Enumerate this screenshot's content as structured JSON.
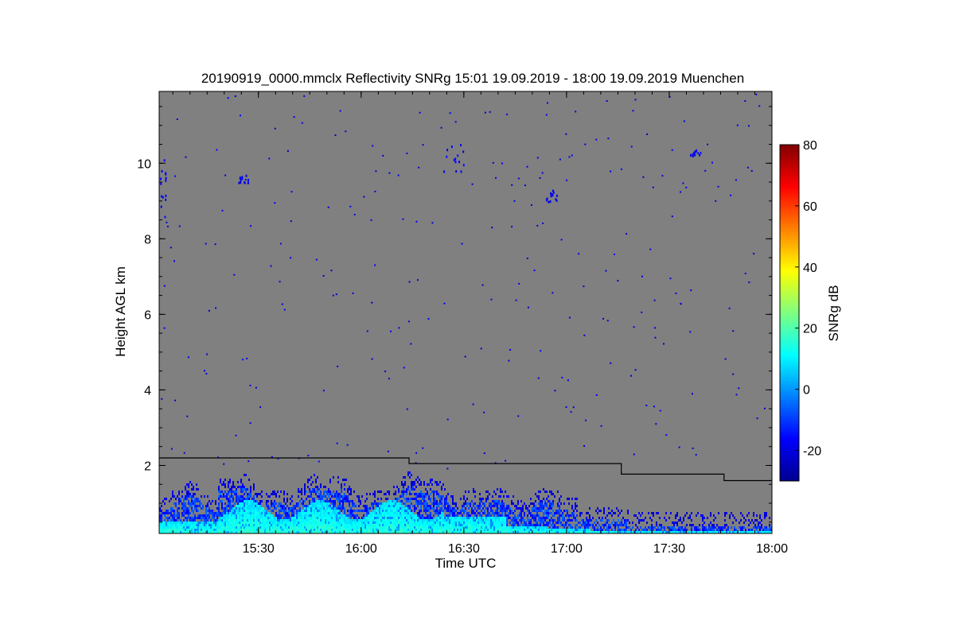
{
  "chart_data": {
    "type": "heatmap",
    "title": "20190919_0000.mmclx Reflectivity SNRg   15:01 19.09.2019 - 18:00 19.09.2019 Muenchen",
    "xlabel": "Time UTC",
    "ylabel": "Height AGL km",
    "colorbar_label": "SNRg dB",
    "x_range_hours": [
      15.0167,
      18.0
    ],
    "y_range_km": [
      0.2,
      11.9
    ],
    "x_tick_values": [
      15.5,
      16.0,
      16.5,
      17.0,
      17.5,
      18.0
    ],
    "x_tick_labels": [
      "15:30",
      "16:00",
      "16:30",
      "17:00",
      "17:30",
      "18:00"
    ],
    "y_tick_values": [
      2,
      4,
      6,
      8,
      10
    ],
    "y_tick_labels": [
      "2",
      "4",
      "6",
      "8",
      "10"
    ],
    "colorbar_range": [
      -30,
      80
    ],
    "colorbar_tick_values": [
      -20,
      0,
      20,
      40,
      60,
      80
    ],
    "colorbar_tick_labels": [
      "-20",
      "0",
      "20",
      "40",
      "60",
      "80"
    ],
    "colormap": "jet",
    "background_color": "#808080",
    "boundary_layer_line": {
      "x_hours": [
        15.0167,
        16.2333,
        16.2333,
        17.2667,
        17.2667,
        17.7667,
        17.7667,
        18.0
      ],
      "y_km": [
        2.2,
        2.2,
        2.05,
        2.05,
        1.77,
        1.77,
        1.6,
        1.6
      ],
      "color": "#000000"
    },
    "echo_regions": [
      {
        "name": "boundary-layer-echo",
        "x_hours": [
          15.0167,
          18.0
        ],
        "snr_db_range": [
          -25,
          15
        ]
      },
      {
        "name": "cirrus-echo-1",
        "x_hours": [
          15.4,
          15.45
        ],
        "y_km": [
          9.5,
          9.7
        ],
        "snr_db": -20
      },
      {
        "name": "cirrus-echo-2",
        "x_hours": [
          16.4,
          16.5
        ],
        "y_km": [
          9.8,
          10.6
        ],
        "snr_db": -20
      },
      {
        "name": "cirrus-echo-3",
        "x_hours": [
          16.9,
          16.95
        ],
        "y_km": [
          9.0,
          9.3
        ],
        "snr_db": -20
      },
      {
        "name": "cirrus-echo-4",
        "x_hours": [
          17.6,
          17.65
        ],
        "y_km": [
          10.2,
          10.4
        ],
        "snr_db": -20
      },
      {
        "name": "cirrus-echo-5",
        "x_hours": [
          15.0167,
          15.05
        ],
        "y_km": [
          8.4,
          10.2
        ],
        "snr_db": -20
      }
    ]
  }
}
